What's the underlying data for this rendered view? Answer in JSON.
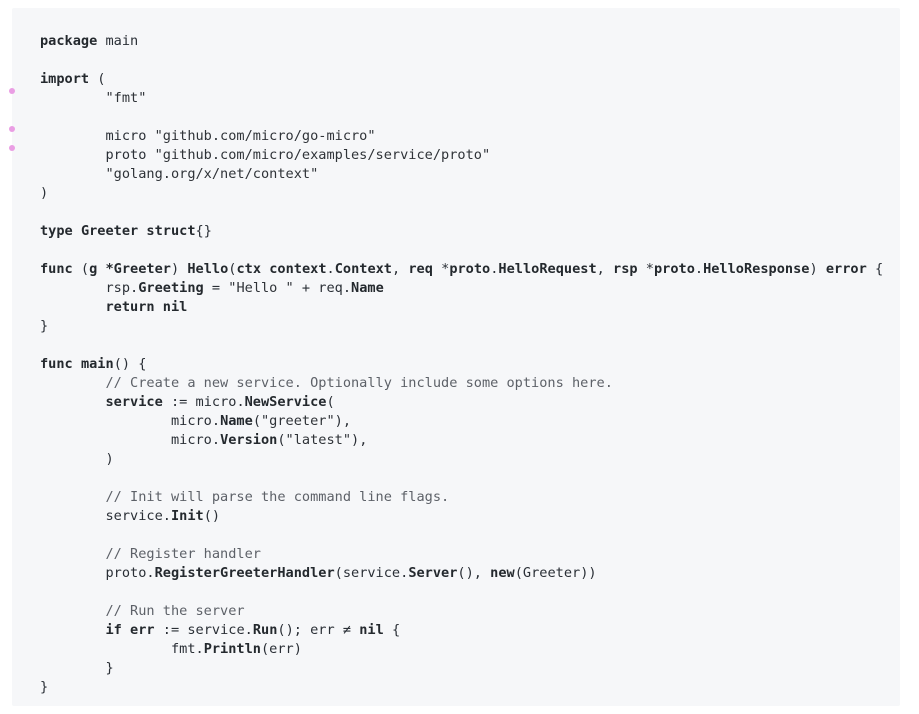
{
  "code": {
    "language": "go",
    "marker_color": "#ea9ee4",
    "lines": [
      [
        {
          "t": "package",
          "k": "k"
        },
        {
          "t": " main"
        }
      ],
      [],
      [
        {
          "t": "import",
          "k": "k"
        },
        {
          "t": " ("
        }
      ],
      [
        {
          "t": "        \"fmt\"",
          "k": "s"
        }
      ],
      [],
      [
        {
          "t": "        micro "
        },
        {
          "t": "\"github.com/micro/go-micro\"",
          "k": "s"
        }
      ],
      [
        {
          "t": "        proto "
        },
        {
          "t": "\"github.com/micro/examples/service/proto\"",
          "k": "s"
        }
      ],
      [
        {
          "t": "        \"golang.org/x/net/context\"",
          "k": "s"
        }
      ],
      [
        {
          "t": ")"
        }
      ],
      [],
      [
        {
          "t": "type",
          "k": "k"
        },
        {
          "t": " "
        },
        {
          "t": "Greeter",
          "k": "f"
        },
        {
          "t": " "
        },
        {
          "t": "struct",
          "k": "k"
        },
        {
          "t": "{}"
        }
      ],
      [],
      [
        {
          "t": "func",
          "k": "k"
        },
        {
          "t": " ("
        },
        {
          "t": "g",
          "k": "f"
        },
        {
          "t": " "
        },
        {
          "t": "*Greeter",
          "k": "f"
        },
        {
          "t": ") "
        },
        {
          "t": "Hello",
          "k": "f"
        },
        {
          "t": "("
        },
        {
          "t": "ctx",
          "k": "f"
        },
        {
          "t": " "
        },
        {
          "t": "context",
          "k": "f"
        },
        {
          "t": "."
        },
        {
          "t": "Context",
          "k": "f"
        },
        {
          "t": ", "
        },
        {
          "t": "req",
          "k": "f"
        },
        {
          "t": " *"
        },
        {
          "t": "proto",
          "k": "f"
        },
        {
          "t": "."
        },
        {
          "t": "HelloRequest",
          "k": "f"
        },
        {
          "t": ", "
        },
        {
          "t": "rsp",
          "k": "f"
        },
        {
          "t": " *"
        },
        {
          "t": "proto",
          "k": "f"
        },
        {
          "t": "."
        },
        {
          "t": "HelloResponse",
          "k": "f"
        },
        {
          "t": ") "
        },
        {
          "t": "error",
          "k": "k"
        },
        {
          "t": " {"
        }
      ],
      [
        {
          "t": "        rsp."
        },
        {
          "t": "Greeting",
          "k": "f"
        },
        {
          "t": " = "
        },
        {
          "t": "\"Hello \"",
          "k": "s"
        },
        {
          "t": " + req."
        },
        {
          "t": "Name",
          "k": "f"
        }
      ],
      [
        {
          "t": "        "
        },
        {
          "t": "return",
          "k": "k"
        },
        {
          "t": " "
        },
        {
          "t": "nil",
          "k": "k"
        }
      ],
      [
        {
          "t": "}"
        }
      ],
      [],
      [
        {
          "t": "func",
          "k": "k"
        },
        {
          "t": " "
        },
        {
          "t": "main",
          "k": "f"
        },
        {
          "t": "() {"
        }
      ],
      [
        {
          "t": "        // Create a new service. Optionally include some options here.",
          "k": "c"
        }
      ],
      [
        {
          "t": "        "
        },
        {
          "t": "service",
          "k": "f"
        },
        {
          "t": " := micro."
        },
        {
          "t": "NewService",
          "k": "f"
        },
        {
          "t": "("
        }
      ],
      [
        {
          "t": "                micro."
        },
        {
          "t": "Name",
          "k": "f"
        },
        {
          "t": "("
        },
        {
          "t": "\"greeter\"",
          "k": "s"
        },
        {
          "t": "),"
        }
      ],
      [
        {
          "t": "                micro."
        },
        {
          "t": "Version",
          "k": "f"
        },
        {
          "t": "("
        },
        {
          "t": "\"latest\"",
          "k": "s"
        },
        {
          "t": "),"
        }
      ],
      [
        {
          "t": "        )"
        }
      ],
      [],
      [
        {
          "t": "        // Init will parse the command line flags.",
          "k": "c"
        }
      ],
      [
        {
          "t": "        service."
        },
        {
          "t": "Init",
          "k": "f"
        },
        {
          "t": "()"
        }
      ],
      [],
      [
        {
          "t": "        // Register handler",
          "k": "c"
        }
      ],
      [
        {
          "t": "        proto."
        },
        {
          "t": "RegisterGreeterHandler",
          "k": "f"
        },
        {
          "t": "(service."
        },
        {
          "t": "Server",
          "k": "f"
        },
        {
          "t": "(), "
        },
        {
          "t": "new",
          "k": "k"
        },
        {
          "t": "(Greeter))"
        }
      ],
      [],
      [
        {
          "t": "        // Run the server",
          "k": "c"
        }
      ],
      [
        {
          "t": "        "
        },
        {
          "t": "if",
          "k": "k"
        },
        {
          "t": " "
        },
        {
          "t": "err",
          "k": "f"
        },
        {
          "t": " := service."
        },
        {
          "t": "Run",
          "k": "f"
        },
        {
          "t": "(); err ≠ "
        },
        {
          "t": "nil",
          "k": "k"
        },
        {
          "t": " {"
        }
      ],
      [
        {
          "t": "                fmt."
        },
        {
          "t": "Println",
          "k": "f"
        },
        {
          "t": "(err)"
        }
      ],
      [
        {
          "t": "        }"
        }
      ],
      [
        {
          "t": "}"
        }
      ]
    ],
    "marker_lines": [
      3,
      5,
      6
    ]
  }
}
